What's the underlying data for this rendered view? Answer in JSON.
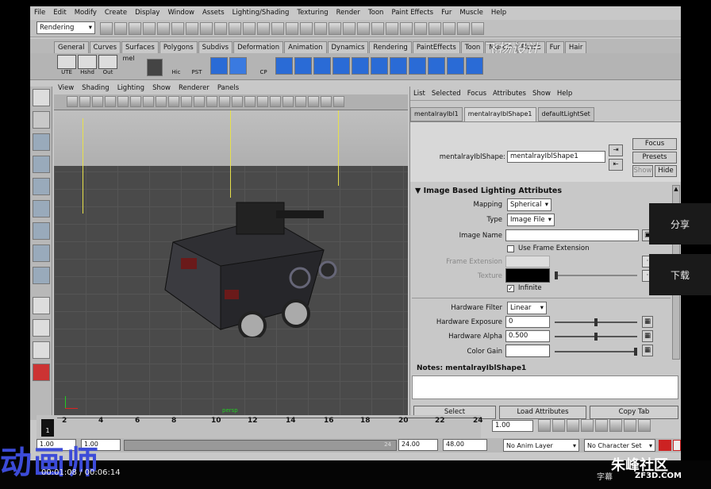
{
  "menubar": [
    "File",
    "Edit",
    "Modify",
    "Create",
    "Display",
    "Window",
    "Assets",
    "Lighting/Shading",
    "Texturing",
    "Render",
    "Toon",
    "Paint Effects",
    "Fur",
    "Muscle",
    "Help"
  ],
  "status_line": {
    "mode": "Rendering"
  },
  "shelf_tabs": [
    "General",
    "Curves",
    "Surfaces",
    "Polygons",
    "Subdivs",
    "Deformation",
    "Animation",
    "Dynamics",
    "Rendering",
    "PaintEffects",
    "Toon",
    "Muscle",
    "Fluids",
    "Fur",
    "Hair"
  ],
  "shelf_buttons": [
    "UTE",
    "Hshd",
    "Out",
    "mel",
    "Hic",
    "PST",
    "CP"
  ],
  "watermark_top": "飞扬设计",
  "viewport": {
    "menus": [
      "View",
      "Shading",
      "Lighting",
      "Show",
      "Renderer",
      "Panels"
    ],
    "persp_label": "persp"
  },
  "attr_editor": {
    "menus": [
      "List",
      "Selected",
      "Focus",
      "Attributes",
      "Show",
      "Help"
    ],
    "tabs": [
      "mentalrayIbl1",
      "mentalrayIblShape1",
      "defaultLightSet"
    ],
    "node_label": "mentalrayIblShape:",
    "node_value": "mentalrayIblShape1",
    "buttons": {
      "focus": "Focus",
      "presets": "Presets",
      "show": "Show",
      "hide": "Hide"
    },
    "section": "Image Based Lighting Attributes",
    "mapping_label": "Mapping",
    "mapping_value": "Spherical",
    "type_label": "Type",
    "type_value": "Image File",
    "image_name_label": "Image Name",
    "image_name_value": "",
    "use_frame_ext": "Use Frame Extension",
    "frame_ext_label": "Frame Extension",
    "texture_label": "Texture",
    "infinite": "Infinite",
    "hw_filter_label": "Hardware Filter",
    "hw_filter_value": "Linear",
    "hw_exposure_label": "Hardware Exposure",
    "hw_exposure_value": "0",
    "hw_alpha_label": "Hardware Alpha",
    "hw_alpha_value": "0.500",
    "color_gain_label": "Color Gain",
    "notes_label": "Notes:  mentalrayIblShape1",
    "bottom_buttons": [
      "Select",
      "Load Attributes",
      "Copy Tab"
    ]
  },
  "timeline": {
    "ticks": [
      "2",
      "4",
      "6",
      "8",
      "10",
      "12",
      "14",
      "16",
      "18",
      "20",
      "22",
      "24"
    ],
    "current_frame": "1",
    "current_field": "1.00"
  },
  "range": {
    "start": "1.00",
    "start2": "1.00",
    "end": "24.00",
    "end2": "48.00",
    "anim_layer": "No Anim Layer",
    "char_set": "No Character Set",
    "slider_mark": "24"
  },
  "side_buttons": {
    "share": "分享",
    "download": "下载"
  },
  "player": {
    "logo": "动画师",
    "time": "00:01:08 / 00:06:14",
    "subtitle_btn": "字幕"
  },
  "brand": {
    "name": "朱峰社区",
    "url": "ZF3D.COM"
  }
}
